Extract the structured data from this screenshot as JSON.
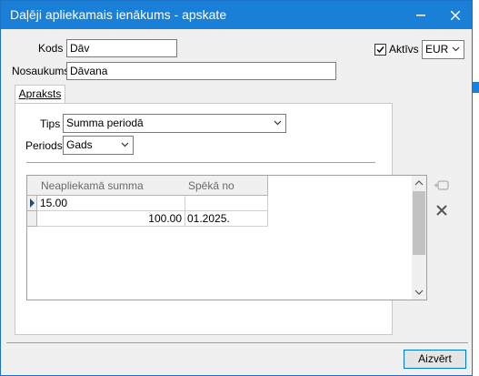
{
  "window": {
    "title": "Daļēji apliekamais ienākums - apskate",
    "minimize_icon": "minimize-icon",
    "close_icon": "close-icon",
    "accent_color": "#1a7fd6"
  },
  "form": {
    "kods_label": "Kods",
    "kods_value": "Dāv",
    "nosaukums_label": "Nosaukums",
    "nosaukums_value": "Dāvana",
    "aktivs_label": "Aktīvs",
    "aktivs_checked": true,
    "currency_value": "EUR"
  },
  "tabs": [
    {
      "label": "Apraksts",
      "active": true
    }
  ],
  "apraksts": {
    "tips_label": "Tips",
    "tips_value": "Summa periodā",
    "periods_label": "Periods",
    "periods_value": "Gads"
  },
  "grid": {
    "columns": [
      "Neapliekamā summa",
      "Spēkā no"
    ],
    "rows": [
      {
        "amount": "15.00",
        "date": "",
        "current": true
      },
      {
        "amount": "100.00",
        "date": "01.2025.",
        "current": false
      }
    ]
  },
  "side_buttons": [
    {
      "icon": "add-row-icon",
      "enabled": false
    },
    {
      "icon": "delete-x-icon",
      "enabled": true
    }
  ],
  "footer": {
    "close_label": "Aizvērt"
  }
}
